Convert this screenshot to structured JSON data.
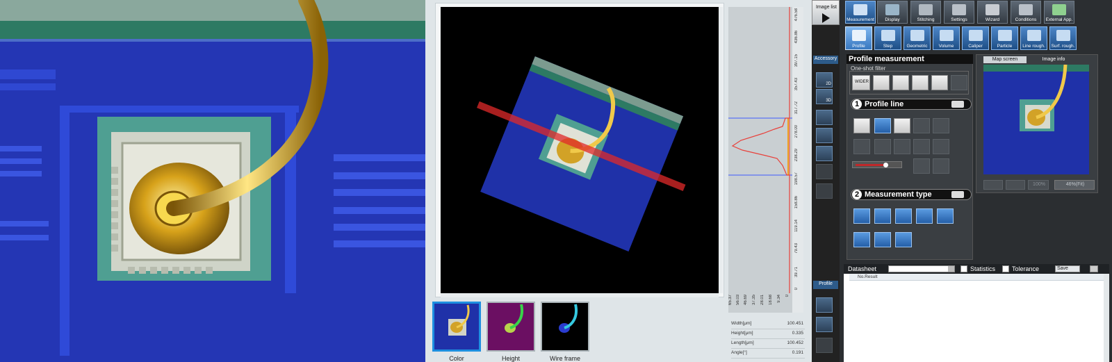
{
  "viewer": {
    "profile_axis_ticks": [
      "476.58",
      "436.86",
      "397.15",
      "357.43",
      "317.72",
      "278.00",
      "238.29",
      "198.57",
      "158.86",
      "119.14",
      "79.43",
      "39.71",
      "0"
    ],
    "profile_bottom_ticks": [
      "65.37",
      "56.03",
      "46.69",
      "37.35",
      "28.01",
      "18.68",
      "9.34",
      "0"
    ],
    "thumbnails": [
      {
        "label": "Color"
      },
      {
        "label": "Height"
      },
      {
        "label": "Wire frame"
      }
    ],
    "readout": [
      {
        "label": "Width[μm]",
        "value": "100.451"
      },
      {
        "label": "Height[μm]",
        "value": "0.335"
      },
      {
        "label": "Length[μm]",
        "value": "100.452"
      },
      {
        "label": "Angle[°]",
        "value": "0.191"
      }
    ]
  },
  "accessory": {
    "image_list_label": "Image list",
    "label": "Accessory",
    "btn_2d": "2D",
    "btn_3d": "3D",
    "profile_label": "Profile"
  },
  "toolbar": {
    "top": [
      "Measurement",
      "Display",
      "Stitching",
      "Settings",
      "Wizard",
      "Conditions",
      "External App."
    ],
    "sub": [
      "Profile",
      "Step",
      "Geometric",
      "Volume",
      "Caliper",
      "Particle",
      "Line rough.",
      "Surf. rough."
    ]
  },
  "profile_panel": {
    "title": "Profile measurement",
    "filter_group": "One-shot filter",
    "filter_wider": "WIDER",
    "step1_num": "1",
    "step1_label": "Profile line",
    "step2_num": "2",
    "step2_label": "Measurement type"
  },
  "map_panel": {
    "tabs": [
      "Map screen",
      "Image info"
    ],
    "zoom_100": "100%",
    "zoom_fit": "46%(Fit)"
  },
  "datasheet": {
    "title": "Datasheet",
    "statistics": "Statistics",
    "tolerance": "Tolerance",
    "save": "Save",
    "col_header": "No.Result"
  },
  "colors": {
    "accent_blue": "#1d8fe0",
    "profile_red": "#e8413b",
    "profile_cursor_orange": "#f0a020",
    "profile_line_blue": "#3f5bff"
  }
}
